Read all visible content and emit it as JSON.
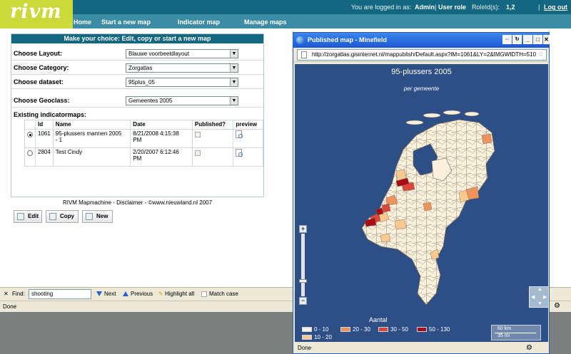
{
  "header": {
    "logo": "rivm",
    "logged_in_prefix": "You are logged in as:",
    "user": "Admin",
    "role_label": "User role",
    "role_ids_label": "RoleId(s):",
    "role_ids": "1,2",
    "logout": "Log out",
    "separator": "|",
    "colors": {
      "topbar": "#136780",
      "subbar": "#3d8ca6",
      "logo_bg": "#cbd93a"
    }
  },
  "nav": [
    "Home",
    "Start a new map",
    "Indicator map",
    "Manage maps"
  ],
  "panel": {
    "title": "Make your choice: Edit, copy or start a new map",
    "fields": [
      {
        "label": "Choose Layout:",
        "value": "Blauwe voorbeeldlayout"
      },
      {
        "label": "Choose Category:",
        "value": "Zorgatlas"
      },
      {
        "label": "Choose dataset:",
        "value": "95plus_05"
      },
      {
        "label": "Choose Geoclass:",
        "value": "Gemeentes 2005"
      }
    ],
    "existing_label": "Existing indicatormaps:",
    "columns": [
      "Id",
      "Name",
      "Date",
      "Published?",
      "preview"
    ],
    "rows": [
      {
        "selected": true,
        "id": "1061",
        "name_line1": "95-plussers mannen 2005",
        "name_line2": "- 1",
        "date_line1": "8/21/2008 4:15:38",
        "date_line2": "PM",
        "published": false
      },
      {
        "selected": false,
        "id": "2804",
        "name_line1": "Test Cindy",
        "name_line2": "",
        "date_line1": "2/20/2007 6:12:46",
        "date_line2": "PM",
        "published": false
      }
    ],
    "buttons": {
      "edit": "Edit",
      "copy": "Copy",
      "new": "New"
    }
  },
  "footer": "RIVM Mapmachine - Disclaimer - ©www.nieuwland.nl 2007",
  "findbar": {
    "close": "✕",
    "find_label": "Find:",
    "find_value": "shooting",
    "next": "Next",
    "previous": "Previous",
    "highlight": "Highlight all",
    "match_case": "Match case"
  },
  "statusbar": {
    "text": "Done"
  },
  "popup": {
    "title": "Published map - Minefield",
    "url": "http://zorgatlas.gisinternet.nl/mappublish/Default.aspx?IM=1061&LY=2&IMGWIDTH=510",
    "map_title": "95-plussers 2005",
    "map_subtitle": "per gemeente",
    "zoom_in": "+",
    "zoom_out": "−",
    "legend": {
      "title": "Aantal",
      "classes": [
        {
          "label": "0 - 10",
          "color": "#fbf0dc"
        },
        {
          "label": "10 - 20",
          "color": "#f7c98e"
        },
        {
          "label": "20 - 30",
          "color": "#f0925c"
        },
        {
          "label": "30 - 50",
          "color": "#d9473b"
        },
        {
          "label": "50 - 130",
          "color": "#a80d14"
        }
      ],
      "scale_km": "60 km",
      "scale_mi": "35 mi"
    },
    "status": "Done"
  }
}
